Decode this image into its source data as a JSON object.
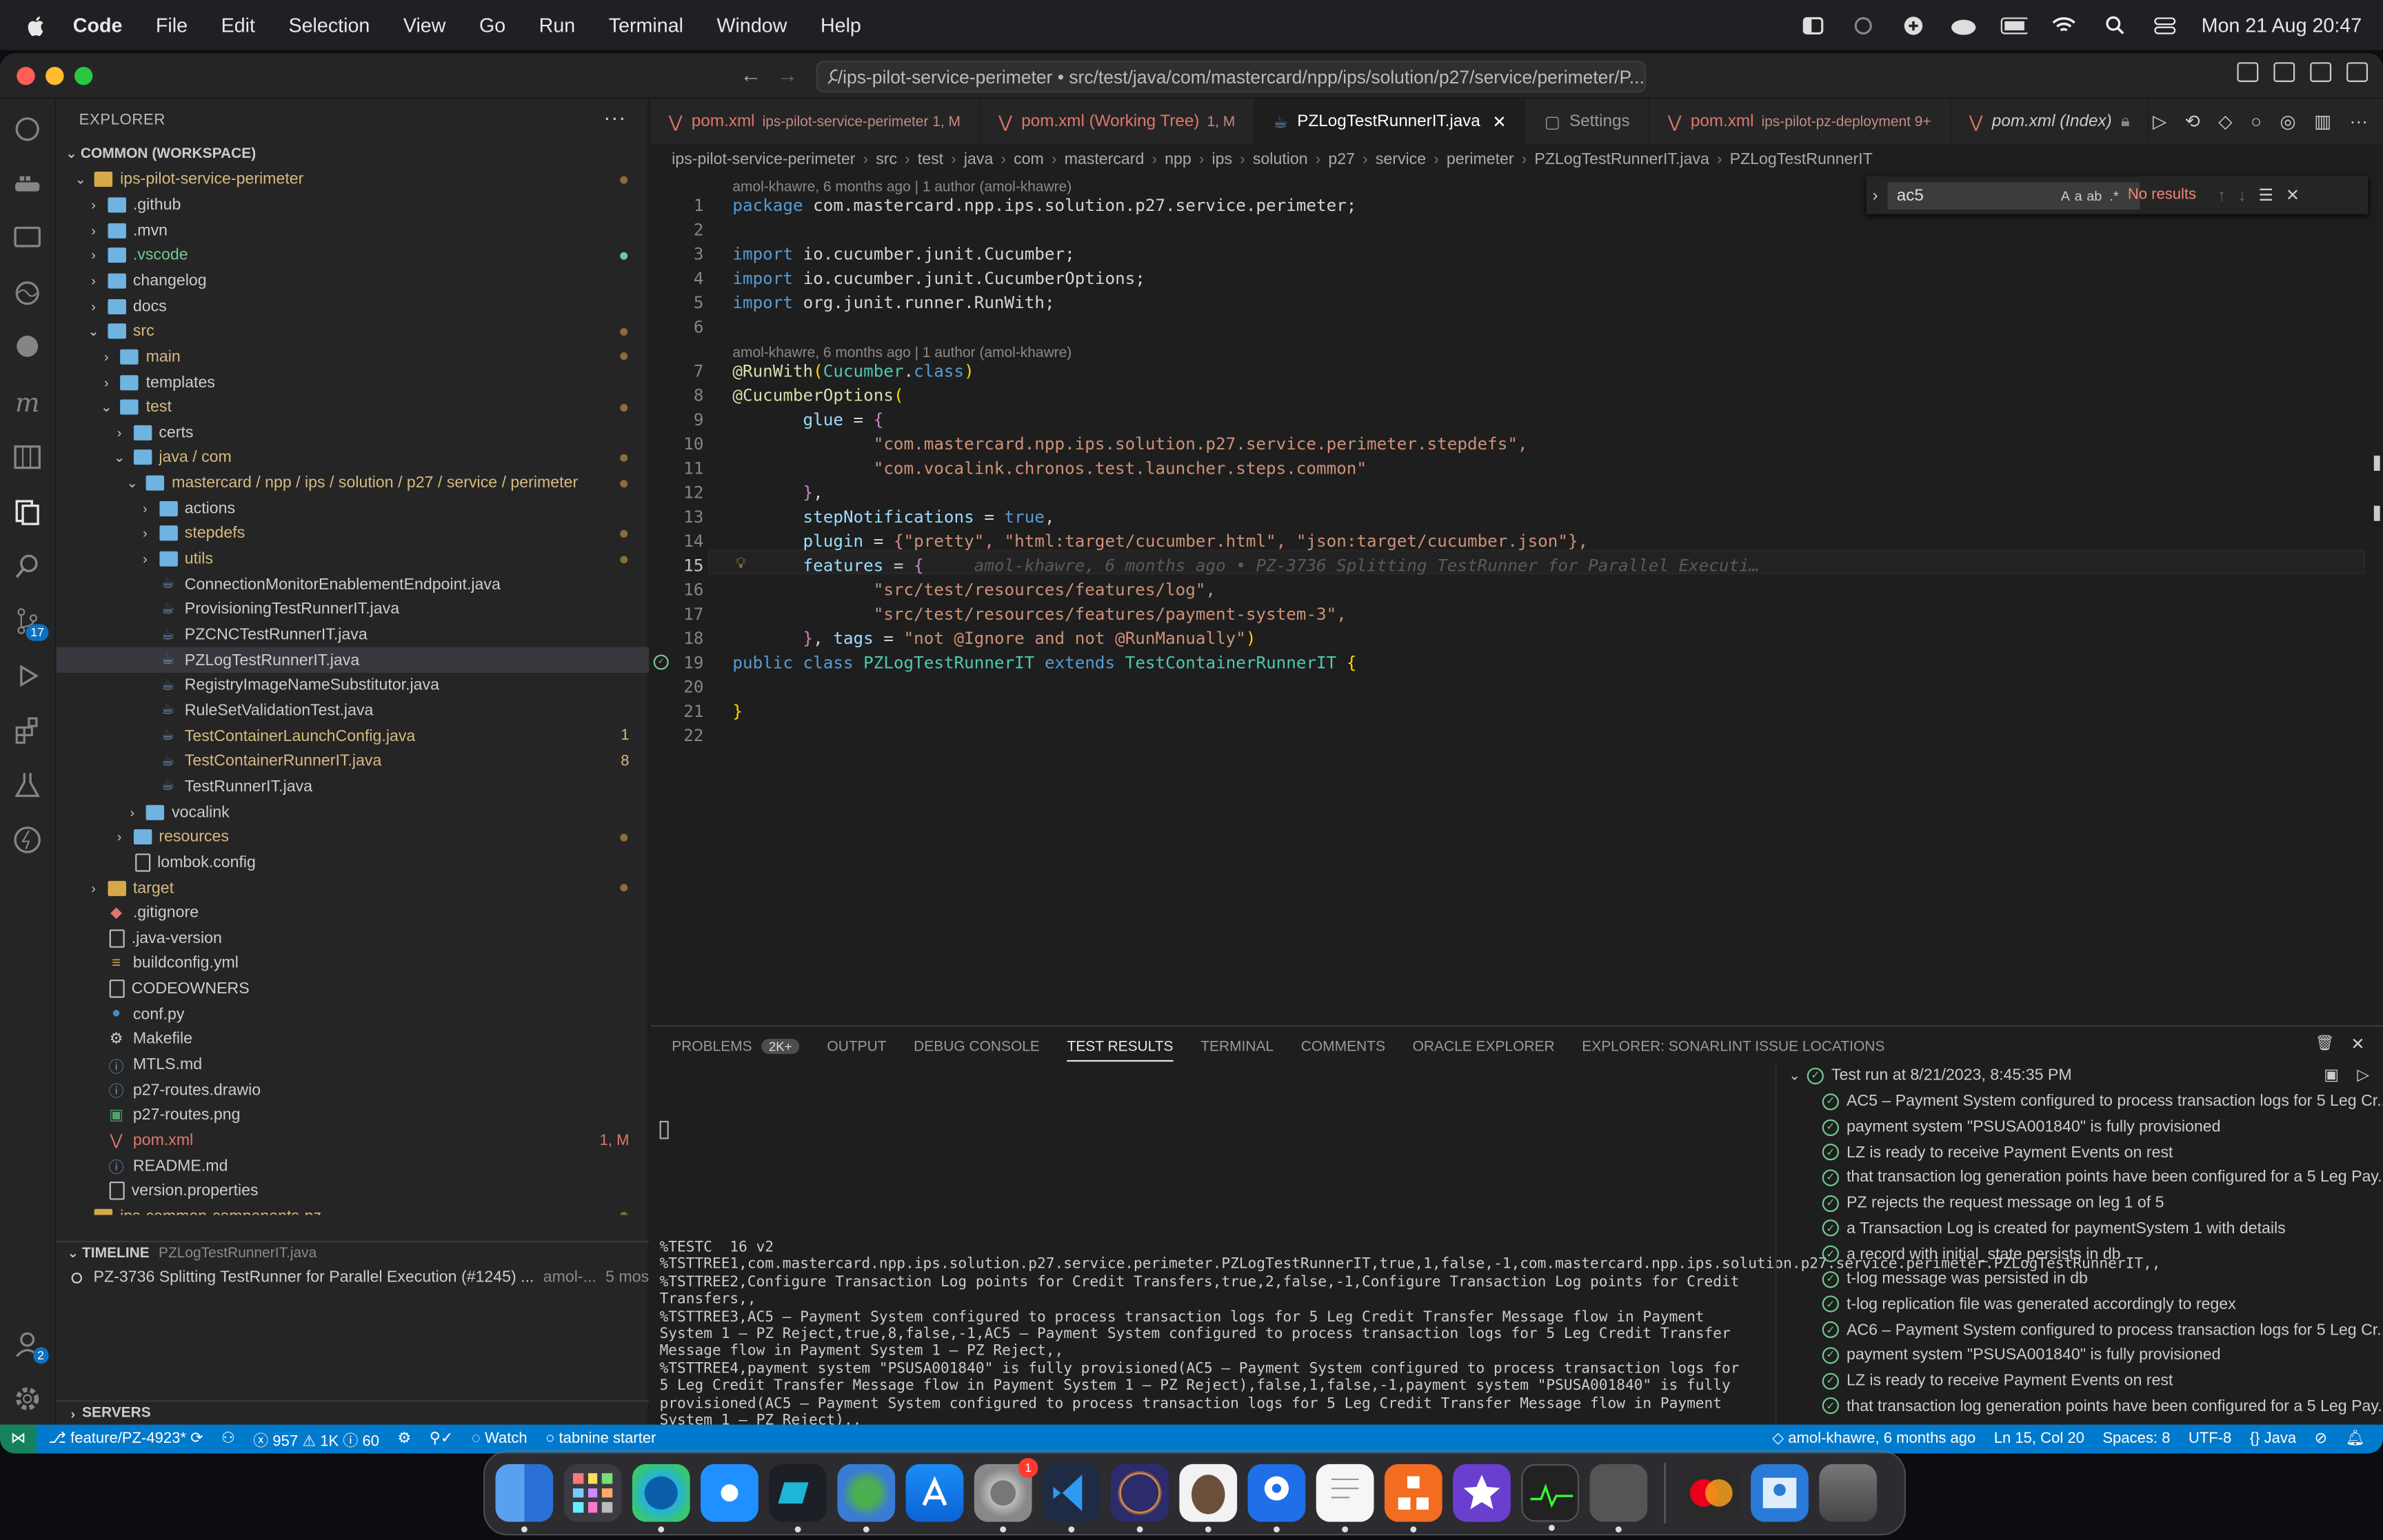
{
  "menubar": {
    "app": "Code",
    "items": [
      "File",
      "Edit",
      "Selection",
      "View",
      "Go",
      "Run",
      "Terminal",
      "Window",
      "Help"
    ],
    "clock": "Mon 21 Aug  20:47"
  },
  "title": {
    "command_center": "/ips-pilot-service-perimeter • src/test/java/com/mastercard/npp/ips/solution/p27/service/perimeter/P..."
  },
  "activity": {
    "source_control_badge": "17",
    "accounts_badge": "2"
  },
  "sidebar": {
    "header": "EXPLORER",
    "workspace": "COMMON (WORKSPACE)",
    "tree": [
      {
        "label": "ips-pilot-service-perimeter",
        "status": "dot"
      },
      {
        "label": ".github"
      },
      {
        "label": ".mvn"
      },
      {
        "label": ".vscode",
        "status": "dot"
      },
      {
        "label": "changelog"
      },
      {
        "label": "docs"
      },
      {
        "label": "src",
        "status": "dot"
      },
      {
        "label": "main",
        "status": "dot"
      },
      {
        "label": "templates"
      },
      {
        "label": "test",
        "status": "dot"
      },
      {
        "label": "certs"
      },
      {
        "label": "java / com",
        "status": "dot"
      },
      {
        "label": "mastercard / npp / ips / solution / p27 / service / perimeter",
        "status": "dot"
      },
      {
        "label": "actions"
      },
      {
        "label": "stepdefs",
        "status": "dot"
      },
      {
        "label": "utils",
        "status": "dot"
      },
      {
        "label": "ConnectionMonitorEnablementEndpoint.java"
      },
      {
        "label": "ProvisioningTestRunnerIT.java"
      },
      {
        "label": "PZCNCTestRunnerIT.java"
      },
      {
        "label": "PZLogTestRunnerIT.java"
      },
      {
        "label": "RegistryImageNameSubstitutor.java"
      },
      {
        "label": "RuleSetValidationTest.java"
      },
      {
        "label": "TestContainerLaunchConfig.java",
        "status": "1"
      },
      {
        "label": "TestContainerRunnerIT.java",
        "status": "8"
      },
      {
        "label": "TestRunnerIT.java"
      },
      {
        "label": "vocalink"
      },
      {
        "label": "resources",
        "status": "dot"
      },
      {
        "label": "lombok.config"
      },
      {
        "label": "target",
        "status": "dot"
      },
      {
        "label": ".gitignore"
      },
      {
        "label": ".java-version"
      },
      {
        "label": "buildconfig.yml"
      },
      {
        "label": "CODEOWNERS"
      },
      {
        "label": "conf.py"
      },
      {
        "label": "Makefile"
      },
      {
        "label": "MTLS.md"
      },
      {
        "label": "p27-routes.drawio"
      },
      {
        "label": "p27-routes.png"
      },
      {
        "label": "pom.xml",
        "status": "1, M"
      },
      {
        "label": "README.md"
      },
      {
        "label": "version.properties"
      },
      {
        "label": "ips-common-components-pz",
        "status": "dot"
      }
    ],
    "timeline": {
      "title": "TIMELINE",
      "file": "PZLogTestRunnerIT.java",
      "entry": "PZ-3736 Splitting TestRunner for Parallel Execution (#1245) ...",
      "author": "amol-...",
      "age": "5 mos"
    },
    "servers": "SERVERS"
  },
  "tabs": [
    {
      "label": "pom.xml",
      "desc": "ips-pilot-service-perimeter 1, M"
    },
    {
      "label": "pom.xml (Working Tree)",
      "desc": "1, M"
    },
    {
      "label": "PZLogTestRunnerIT.java",
      "desc": ""
    },
    {
      "label": "Settings",
      "desc": ""
    },
    {
      "label": "pom.xml",
      "desc": "ips-pilot-pz-deployment 9+"
    },
    {
      "label": "pom.xml (Index)",
      "desc": ""
    }
  ],
  "breadcrumbs": [
    "ips-pilot-service-perimeter",
    "src",
    "test",
    "java",
    "com",
    "mastercard",
    "npp",
    "ips",
    "solution",
    "p27",
    "service",
    "perimeter",
    "PZLogTestRunnerIT.java",
    "PZLogTestRunnerIT"
  ],
  "find": {
    "value": "ac5",
    "result": "No results"
  },
  "editor": {
    "blame": "amol-khawre, 6 months ago | 1 author (amol-khawre)",
    "inline_blame": "amol-khawre, 6 months ago • PZ-3736 Splitting TestRunner for Parallel Executi…",
    "line_numbers": [
      "1",
      "2",
      "3",
      "4",
      "5",
      "6",
      "7",
      "8",
      "9",
      "10",
      "11",
      "12",
      "13",
      "14",
      "15",
      "16",
      "17",
      "18",
      "19",
      "20",
      "21",
      "22"
    ],
    "package_name": "com.mastercard.npp.ips.solution.p27.service.perimeter",
    "imports": [
      "io.cucumber.junit.Cucumber",
      "io.cucumber.junit.CucumberOptions",
      "org.junit.runner.RunWith"
    ],
    "glue": [
      "\"com.mastercard.npp.ips.solution.p27.service.perimeter.stepdefs\",",
      "\"com.vocalink.chronos.test.launcher.steps.common\""
    ],
    "plugin": "{\"pretty\", \"html:target/cucumber.html\", \"json:target/cucumber.json\"},",
    "features": [
      "\"src/test/resources/features/log\",",
      "\"src/test/resources/features/payment-system-3\","
    ],
    "tags": "\"not @Ignore and not @RunManually\"",
    "class_name": "PZLogTestRunnerIT",
    "parent": "TestContainerRunnerIT"
  },
  "panel": {
    "tabs": [
      "PROBLEMS",
      "OUTPUT",
      "DEBUG CONSOLE",
      "TEST RESULTS",
      "TERMINAL",
      "COMMENTS",
      "ORACLE EXPLORER",
      "EXPLORER: SONARLINT ISSUE LOCATIONS"
    ],
    "problems_badge": "2K+",
    "output": "%TESTC  16 v2\n%TSTTREE1,com.mastercard.npp.ips.solution.p27.service.perimeter.PZLogTestRunnerIT,true,1,false,-1,com.mastercard.npp.ips.solution.p27.service.perimeter.PZLogTestRunnerIT,,\n%TSTTREE2,Configure Transaction Log points for Credit Transfers,true,2,false,-1,Configure Transaction Log points for Credit Transfers,,\n%TSTTREE3,AC5 – Payment System configured to process transaction logs for 5 Leg Credit Transfer Message flow in Payment System 1 – PZ Reject,true,8,false,-1,AC5 – Payment System configured to process transaction logs for 5 Leg Credit Transfer Message flow in Payment System 1 – PZ Reject,,\n%TSTTREE4,payment system \"PSUSA001840\" is fully provisioned(AC5 – Payment System configured to process transaction logs for 5 Leg Credit Transfer Message flow in Payment System 1 – PZ Reject),false,1,false,-1,payment system \"PSUSA001840\" is fully provisioned(AC5 – Payment System configured to process transaction logs for 5 Leg Credit Transfer Message flow in Payment System 1 – PZ Reject),,",
    "test_run": "Test run at 8/21/2023, 8:45:35 PM",
    "results": [
      "AC5 – Payment System configured to process transaction logs for 5 Leg Cr...",
      "payment system \"PSUSA001840\" is fully provisioned",
      "LZ is ready to receive Payment Events on rest",
      "that transaction log generation points have been configured for a 5 Leg Pay...",
      "PZ rejects the request message on leg 1 of 5",
      "a Transaction Log is created for paymentSystem 1 with details",
      "a record with initial_state persists in db",
      "t-log message was persisted in db",
      "t-log replication file was generated accordingly to regex",
      "AC6 – Payment System configured to process transaction logs for 5 Leg Cr...",
      "payment system \"PSUSA001840\" is fully provisioned",
      "LZ is ready to receive Payment Events on rest",
      "that transaction log generation points have been configured for a 5 Leg Pay..."
    ]
  },
  "status": {
    "branch": "feature/PZ-4923*",
    "problems": "957",
    "warnings": "1K",
    "infos": "60",
    "watch": "Watch",
    "tabnine": "tabnine starter",
    "blame": "amol-khawre, 6 months ago",
    "position": "Ln 15, Col 20",
    "spaces": "Spaces: 8",
    "encoding": "UTF-8",
    "language": "Java"
  },
  "dock": {
    "settings_badge": "1"
  }
}
